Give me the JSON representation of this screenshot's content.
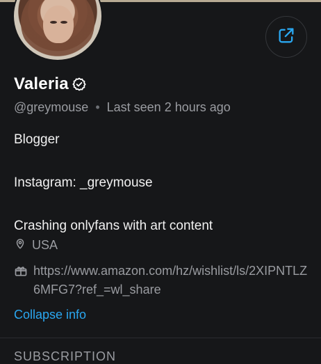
{
  "profile": {
    "name": "Valeria",
    "handle": "@greymouse",
    "separator": "•",
    "last_seen": "Last seen 2 hours ago"
  },
  "bio": {
    "line1": "Blogger",
    "line2": "Instagram: _greymouse",
    "line3": "Crashing onlyfans with art content"
  },
  "location": {
    "text": "USA"
  },
  "wishlist": {
    "url": "https://www.amazon.com/hz/wishlist/ls/2XIPNTLZ6MFG7?ref_=wl_share"
  },
  "actions": {
    "collapse_label": "Collapse info"
  },
  "section": {
    "title": "SUBSCRIPTION"
  },
  "colors": {
    "accent": "#2aa7f0",
    "background": "#161719",
    "muted": "#9a9ca1"
  },
  "icons": {
    "share": "share-icon",
    "verified": "verified-badge-icon",
    "location": "location-pin-icon",
    "wishlist": "gift-icon"
  }
}
